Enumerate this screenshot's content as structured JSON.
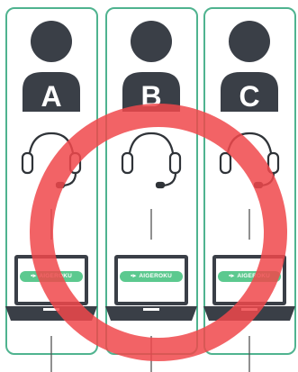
{
  "agents": [
    {
      "letter": "A",
      "brand_text": "AIGEROKU",
      "brand_glyph": "▪▸"
    },
    {
      "letter": "B",
      "brand_text": "AIGEROKU",
      "brand_glyph": "▪▸"
    },
    {
      "letter": "C",
      "brand_text": "AIGEROKU",
      "brand_glyph": "▪▸"
    }
  ],
  "colors": {
    "panel_border": "#4fb38f",
    "person": "#3a3f47",
    "brand_bg": "#5cc98f",
    "prohibition_ring": "#f0484b"
  },
  "icons": [
    "person-icon",
    "headset-icon",
    "laptop-icon",
    "prohibition-icon"
  ]
}
